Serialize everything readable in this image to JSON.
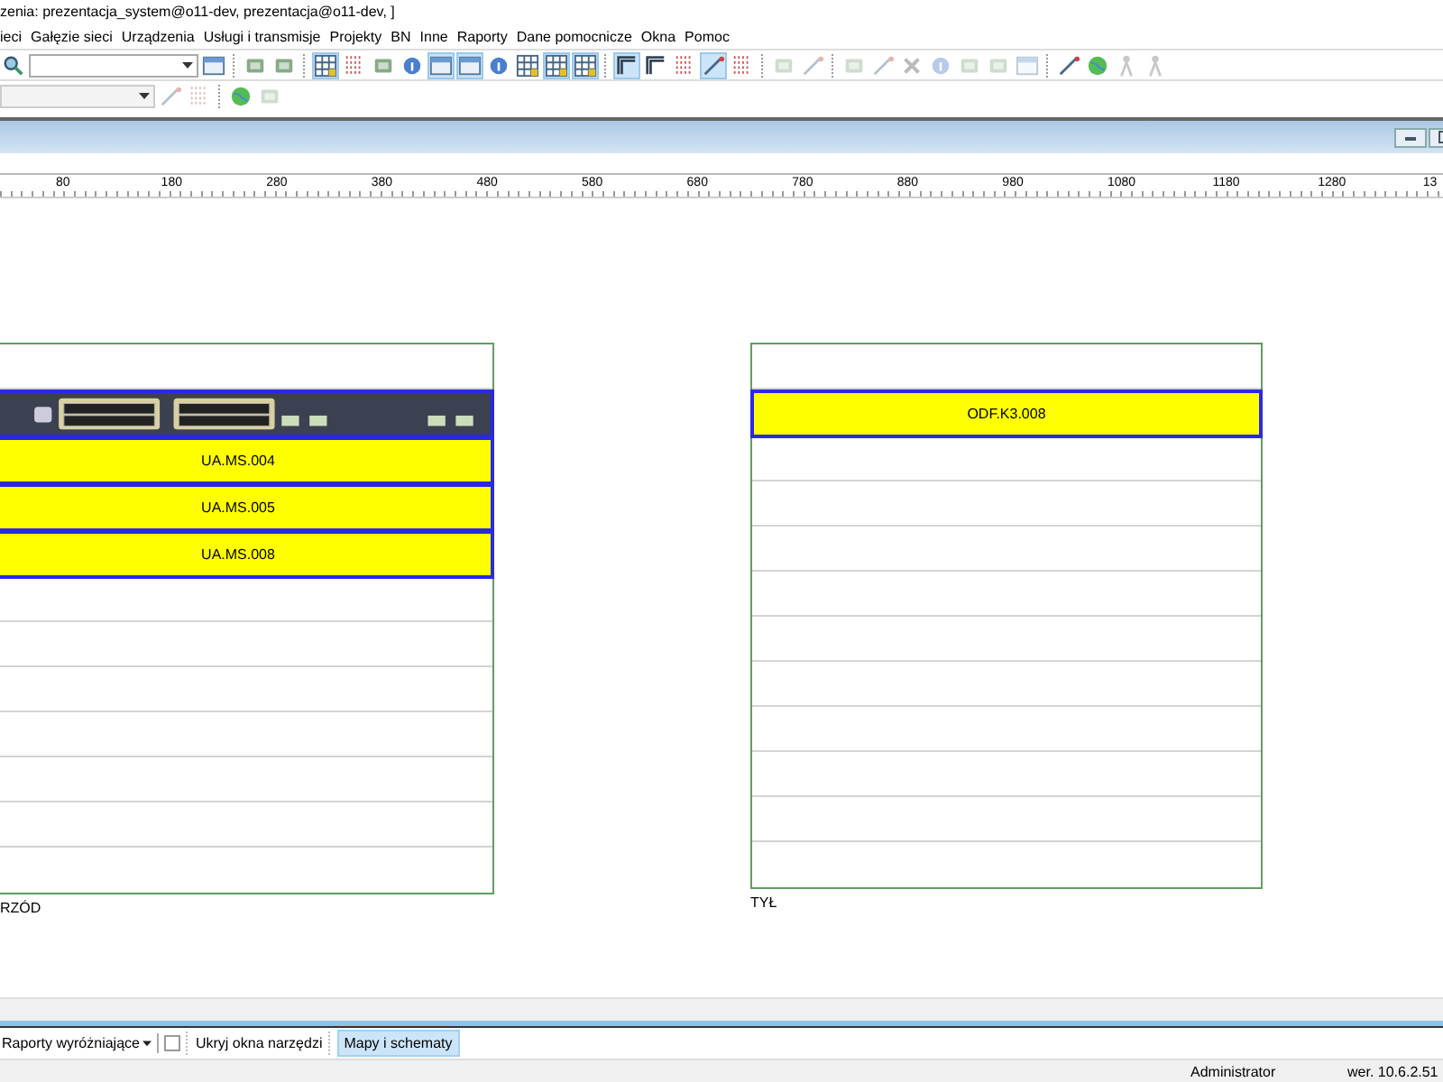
{
  "title": "zenia: prezentacja_system@o11-dev, prezentacja@o11-dev, ]",
  "menu": [
    "ieci",
    "Gałęzie sieci",
    "Urządzenia",
    "Usługi i transmisje",
    "Projekty",
    "BN",
    "Inne",
    "Raporty",
    "Dane pomocnicze",
    "Okna",
    "Pomoc"
  ],
  "toolbar_1": [
    {
      "kind": "search",
      "pressed": false,
      "disabled": false
    },
    {
      "kind": "combo",
      "disabled": false
    },
    {
      "kind": "window",
      "pressed": false,
      "disabled": false
    },
    {
      "kind": "separator"
    },
    {
      "kind": "square",
      "pressed": false,
      "disabled": false
    },
    {
      "kind": "square",
      "pressed": false,
      "disabled": false
    },
    {
      "kind": "separator"
    },
    {
      "kind": "grid",
      "pressed": true,
      "disabled": false
    },
    {
      "kind": "dots",
      "pressed": false,
      "disabled": false
    },
    {
      "kind": "square",
      "pressed": false,
      "disabled": false
    },
    {
      "kind": "circle",
      "pressed": false,
      "disabled": false
    },
    {
      "kind": "window",
      "pressed": true,
      "disabled": false
    },
    {
      "kind": "window",
      "pressed": true,
      "disabled": false
    },
    {
      "kind": "circle",
      "pressed": false,
      "disabled": false
    },
    {
      "kind": "grid",
      "pressed": false,
      "disabled": false
    },
    {
      "kind": "grid",
      "pressed": true,
      "disabled": false
    },
    {
      "kind": "grid",
      "pressed": true,
      "disabled": false
    },
    {
      "kind": "separator"
    },
    {
      "kind": "frame",
      "pressed": true,
      "disabled": false
    },
    {
      "kind": "frame",
      "pressed": false,
      "disabled": false
    },
    {
      "kind": "dots",
      "pressed": false,
      "disabled": false
    },
    {
      "kind": "line",
      "pressed": true,
      "disabled": false
    },
    {
      "kind": "dots",
      "pressed": false,
      "disabled": false
    },
    {
      "kind": "separator"
    },
    {
      "kind": "square",
      "pressed": false,
      "disabled": true
    },
    {
      "kind": "line",
      "pressed": false,
      "disabled": true
    },
    {
      "kind": "separator"
    },
    {
      "kind": "square",
      "pressed": false,
      "disabled": true
    },
    {
      "kind": "line",
      "pressed": false,
      "disabled": true
    },
    {
      "kind": "cross",
      "pressed": false,
      "disabled": true
    },
    {
      "kind": "circle",
      "pressed": false,
      "disabled": true
    },
    {
      "kind": "square",
      "pressed": false,
      "disabled": true
    },
    {
      "kind": "square",
      "pressed": false,
      "disabled": true
    },
    {
      "kind": "window",
      "pressed": false,
      "disabled": true
    },
    {
      "kind": "separator"
    },
    {
      "kind": "line",
      "pressed": false,
      "disabled": false
    },
    {
      "kind": "globe",
      "pressed": false,
      "disabled": false
    },
    {
      "kind": "figure",
      "pressed": false,
      "disabled": true
    },
    {
      "kind": "figure",
      "pressed": false,
      "disabled": true
    }
  ],
  "toolbar_2": [
    {
      "kind": "combo",
      "disabled": true
    },
    {
      "kind": "line",
      "pressed": false,
      "disabled": true
    },
    {
      "kind": "dots",
      "pressed": false,
      "disabled": true
    },
    {
      "kind": "separator"
    },
    {
      "kind": "globe",
      "pressed": false,
      "disabled": false
    },
    {
      "kind": "square",
      "pressed": false,
      "disabled": true
    }
  ],
  "ruler": [
    "80",
    "180",
    "280",
    "380",
    "480",
    "580",
    "680",
    "780",
    "880",
    "980",
    "1080",
    "1180",
    "1280",
    "13"
  ],
  "racks": [
    {
      "label": "RZÓD",
      "cut": true,
      "slots": [
        {
          "kind": "empty"
        },
        {
          "kind": "switch"
        },
        {
          "kind": "device",
          "label": "UA.MS.004"
        },
        {
          "kind": "device",
          "label": "UA.MS.005"
        },
        {
          "kind": "device",
          "label": "UA.MS.008"
        },
        {
          "kind": "empty"
        },
        {
          "kind": "empty"
        },
        {
          "kind": "empty"
        },
        {
          "kind": "empty"
        },
        {
          "kind": "empty"
        },
        {
          "kind": "empty"
        },
        {
          "kind": "empty"
        }
      ]
    },
    {
      "label": "TYŁ",
      "cut": false,
      "slots": [
        {
          "kind": "empty"
        },
        {
          "kind": "device",
          "label": "ODF.K3.008"
        },
        {
          "kind": "empty"
        },
        {
          "kind": "empty"
        },
        {
          "kind": "empty"
        },
        {
          "kind": "empty"
        },
        {
          "kind": "empty"
        },
        {
          "kind": "empty"
        },
        {
          "kind": "empty"
        },
        {
          "kind": "empty"
        },
        {
          "kind": "empty"
        },
        {
          "kind": "empty"
        }
      ]
    }
  ],
  "bottom_bar": {
    "reports_menu": "Raporty wyróżniające",
    "checked": false,
    "hide_tools": "Ukryj okna narzędzi",
    "tabs": [
      {
        "label": "Mapy i schematy",
        "selected": true
      }
    ]
  },
  "status_bar": {
    "user": "Administrator",
    "version": "wer. 10.6.2.51"
  }
}
